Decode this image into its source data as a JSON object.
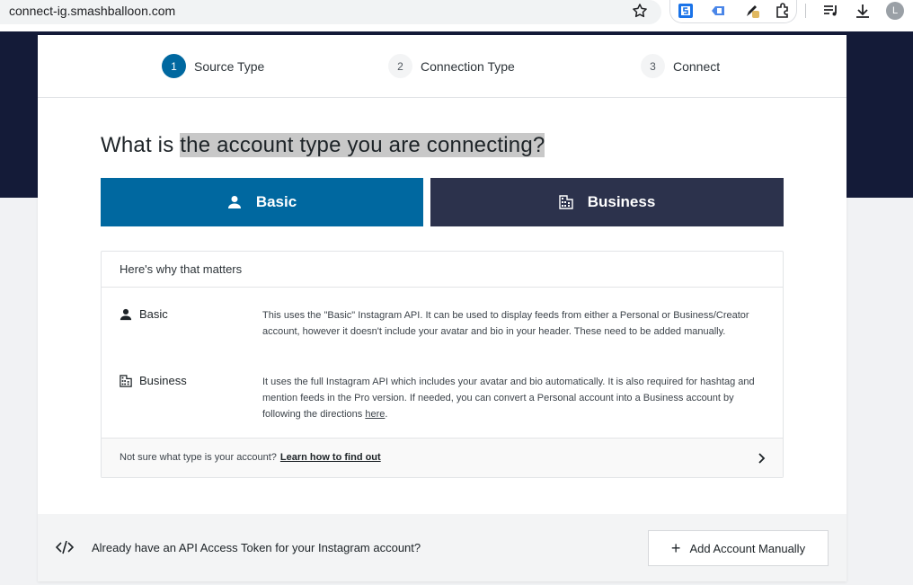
{
  "browser": {
    "url": "connect-ig.smashballoon.com",
    "avatar_letter": "L"
  },
  "steps": [
    {
      "num": "1",
      "label": "Source Type"
    },
    {
      "num": "2",
      "label": "Connection Type"
    },
    {
      "num": "3",
      "label": "Connect"
    }
  ],
  "main": {
    "heading_start": "What is ",
    "heading_highlight": "the account type you are connecting?",
    "btn_basic": "Basic",
    "btn_business": "Business"
  },
  "info": {
    "title": "Here's why that matters",
    "basic_name": "Basic",
    "basic_desc": "This uses the \"Basic\" Instagram API. It can be used to display feeds from either a Personal or Business/Creator account, however it doesn't include your avatar and bio in your header. These need to be added manually.",
    "business_name": "Business",
    "business_desc": "It uses the full Instagram API which includes your avatar and bio automatically. It is also required for hashtag and mention feeds in the Pro version. If needed, you can convert a Personal account into a Business account by following the directions ",
    "business_link": "here",
    "business_end": ".",
    "foot_question": "Not sure what type is your account?",
    "foot_link": "Learn how to find out"
  },
  "footer": {
    "text": "Already have an API Access Token for your Instagram account?",
    "add_plus": "+",
    "add_label": "Add Account Manually"
  },
  "colors": {
    "accent": "#0068a0",
    "dark": "#141b38",
    "business": "#2c324c"
  }
}
